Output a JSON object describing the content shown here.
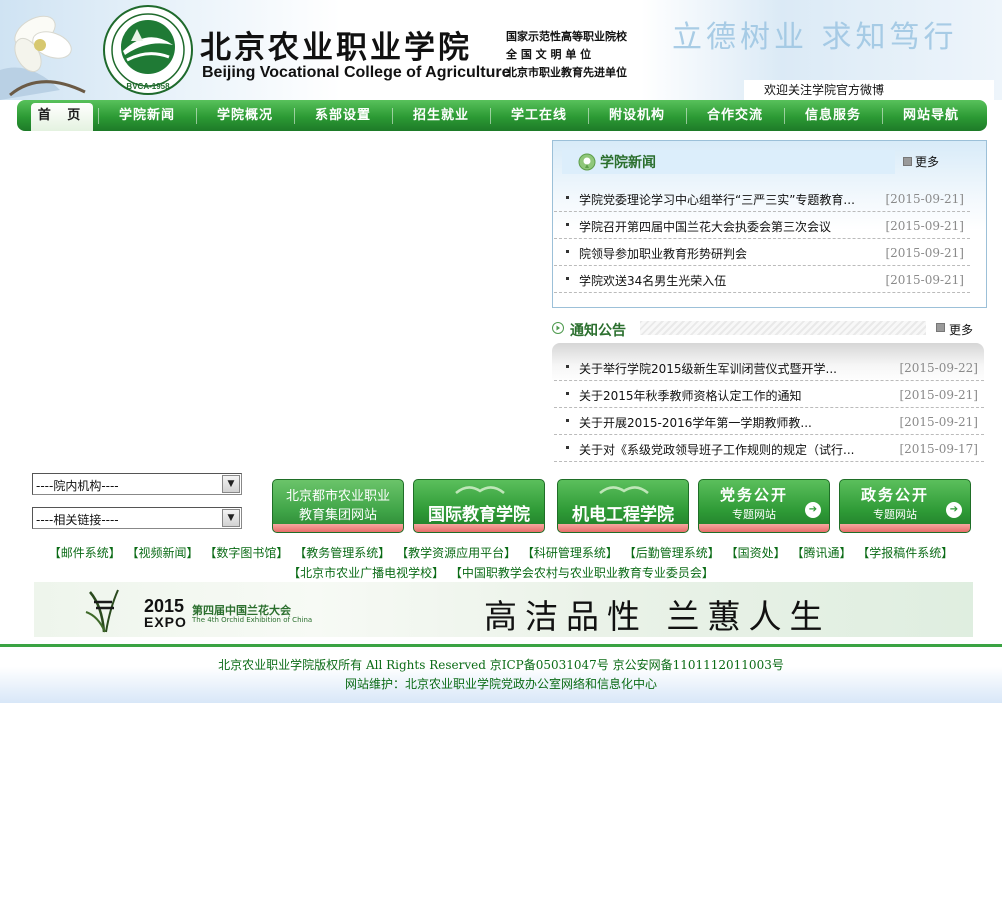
{
  "header": {
    "college_name_cn": "北京农业职业学院",
    "college_name_en": "Beijing Vocational College of Agriculture",
    "logo_text": "BVCA-1958",
    "honors": [
      "国家示范性高等职业院校",
      "全 国 文 明 单 位",
      "北京市职业教育先进单位"
    ],
    "calligraphy": "立德树业 求知笃行",
    "weibo": "欢迎关注学院官方微博"
  },
  "nav": {
    "items": [
      "首 页",
      "学院新闻",
      "学院概况",
      "系部设置",
      "招生就业",
      "学工在线",
      "附设机构",
      "合作交流",
      "信息服务",
      "网站导航"
    ]
  },
  "news": {
    "title": "学院新闻",
    "more": "更多",
    "items": [
      {
        "title": "学院党委理论学习中心组举行“三严三实”专题教育...",
        "date": "[2015-09-21]"
      },
      {
        "title": "学院召开第四届中国兰花大会执委会第三次会议",
        "date": "[2015-09-21]"
      },
      {
        "title": "院领导参加职业教育形势研判会",
        "date": "[2015-09-21]"
      },
      {
        "title": "学院欢送34名男生光荣入伍",
        "date": "[2015-09-21]"
      }
    ]
  },
  "notice": {
    "title": "通知公告",
    "more": "更多",
    "items": [
      {
        "title": "关于举行学院2015级新生军训闭营仪式暨开学...",
        "date": "[2015-09-22]"
      },
      {
        "title": "关于2015年秋季教师资格认定工作的通知",
        "date": "[2015-09-21]"
      },
      {
        "title": "关于开展2015-2016学年第一学期教师教...",
        "date": "[2015-09-21]"
      },
      {
        "title": "关于对《系级党政领导班子工作规则的规定（试行...",
        "date": "[2015-09-17]"
      }
    ]
  },
  "selects": {
    "internal": "----院内机构----",
    "links": "----相关链接----"
  },
  "banners": [
    {
      "line1": "北京都市农业职业",
      "line2": "教育集团网站"
    },
    {
      "line1": "国际教育学院",
      "line2": ""
    },
    {
      "line1": "机电工程学院",
      "line2": ""
    },
    {
      "line1": "党务公开",
      "line2": "专题网站"
    },
    {
      "line1": "政务公开",
      "line2": "专题网站"
    }
  ],
  "quick_links": {
    "row1": [
      "【邮件系统】",
      "【视频新闻】",
      "【数字图书馆】",
      "【教务管理系统】",
      "【教学资源应用平台】",
      "【科研管理系统】",
      "【后勤管理系统】",
      "【国资处】",
      "【腾讯通】",
      "【学报稿件系统】"
    ],
    "row2": [
      "【北京市农业广播电视学校】",
      "【中国职教学会农村与农业职业教育专业委员会】"
    ]
  },
  "expo": {
    "year": "2015",
    "word": "EXPO",
    "name_cn": "第四届中国兰花大会",
    "name_en": "The 4th Orchid Exhibition of China",
    "slogan": "高洁品性 兰蕙人生"
  },
  "footer": {
    "line1": "北京农业职业学院版权所有  All Rights Reserved  京ICP备05031047号  京公安网备1101112011003号",
    "line2": "网站维护：北京农业职业学院党政办公室网络和信息化中心"
  },
  "colors": {
    "nav_green": "#2c9a34",
    "title_green": "#2b6f2e",
    "link_green": "#0b6b16",
    "date_gray": "#8a8a8a"
  }
}
